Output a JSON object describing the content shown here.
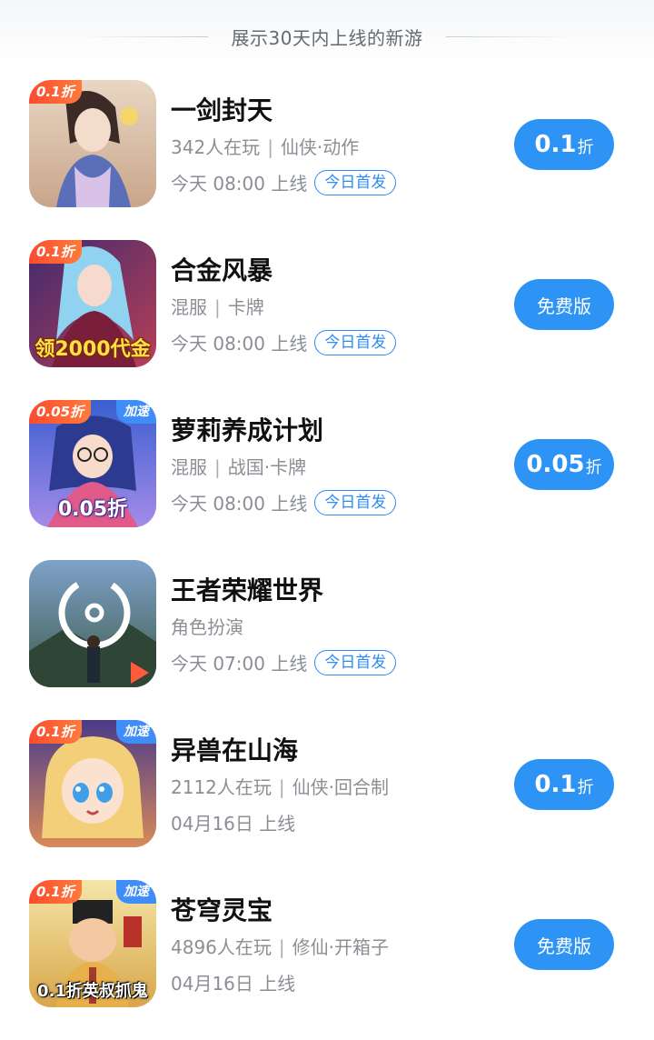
{
  "header": {
    "title": "展示30天内上线的新游"
  },
  "colors": {
    "accent": "#2d93f5",
    "tag": "#2c8cf4",
    "discount_badge": "#ff4a2e",
    "speed_badge": "#3f8ef7"
  },
  "games": [
    {
      "name": "一剑封天",
      "meta_left": "342人在玩",
      "meta_right": "仙侠·动作",
      "launch": "今天 08:00 上线",
      "tag": "今日首发",
      "badge_discount": "0.1折",
      "badge_speed": "",
      "icon_caption": "",
      "cta_num": "0.1",
      "cta_unit": "折",
      "cta_text": ""
    },
    {
      "name": "合金风暴",
      "meta_left": "混服",
      "meta_right": "卡牌",
      "launch": "今天 08:00 上线",
      "tag": "今日首发",
      "badge_discount": "0.1折",
      "badge_speed": "",
      "icon_caption": "领2000代金",
      "cta_num": "",
      "cta_unit": "",
      "cta_text": "免费版"
    },
    {
      "name": "萝莉养成计划",
      "meta_left": "混服",
      "meta_right": "战国·卡牌",
      "launch": "今天 08:00 上线",
      "tag": "今日首发",
      "badge_discount": "0.05折",
      "badge_speed": "加速",
      "icon_caption": "0.05折",
      "cta_num": "0.05",
      "cta_unit": "折",
      "cta_text": ""
    },
    {
      "name": "王者荣耀世界",
      "meta_left": "角色扮演",
      "meta_right": "",
      "launch": "今天 07:00 上线",
      "tag": "今日首发",
      "badge_discount": "",
      "badge_speed": "",
      "icon_caption": "",
      "cta_num": "",
      "cta_unit": "",
      "cta_text": ""
    },
    {
      "name": "异兽在山海",
      "meta_left": "2112人在玩",
      "meta_right": "仙侠·回合制",
      "launch": "04月16日 上线",
      "tag": "",
      "badge_discount": "0.1折",
      "badge_speed": "加速",
      "icon_caption": "",
      "cta_num": "0.1",
      "cta_unit": "折",
      "cta_text": ""
    },
    {
      "name": "苍穹灵宝",
      "meta_left": "4896人在玩",
      "meta_right": "修仙·开箱子",
      "launch": "04月16日 上线",
      "tag": "",
      "badge_discount": "0.1折",
      "badge_speed": "加速",
      "icon_caption": "0.1折英叔抓鬼",
      "cta_num": "",
      "cta_unit": "",
      "cta_text": "免费版"
    }
  ]
}
